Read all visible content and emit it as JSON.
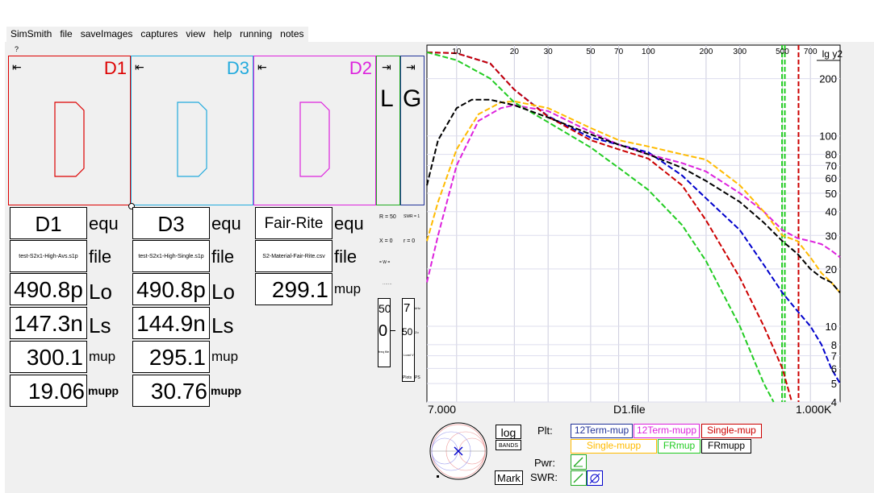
{
  "menu": [
    "SimSmith",
    "file",
    "saveImages",
    "captures",
    "view",
    "help",
    "running",
    "notes"
  ],
  "help_mark": "?",
  "colors": {
    "d1": "#dd0000",
    "d3": "#22aadd",
    "d2": "#dd22dd",
    "green": "#22aa22",
    "navy": "#223399",
    "black": "#000000",
    "orange": "#ffbb00",
    "blue": "#0000cc"
  },
  "devices": {
    "d1": {
      "label": "D1",
      "arrow": "⇤"
    },
    "d3": {
      "label": "D3",
      "arrow": "⇤"
    },
    "d2": {
      "label": "D2",
      "arrow": "⇤"
    },
    "l": {
      "label": "L",
      "arrow": "⇥"
    },
    "g": {
      "label": "G",
      "arrow": "⇥"
    }
  },
  "panels": {
    "d1": {
      "name": "D1",
      "equ": "equ",
      "file_value": "test-S2x1-High-Avs.s1p",
      "file": "file",
      "lo_value": "490.8p",
      "lo": "Lo",
      "ls_value": "147.3n",
      "ls": "Ls",
      "mup_value": "300.1",
      "mup": "mup",
      "mupp_value": "19.06",
      "mupp": "mupp"
    },
    "d3": {
      "name": "D3",
      "equ": "equ",
      "file_value": "test-S2x1-High-Single.s1p",
      "file": "file",
      "lo_value": "490.8p",
      "lo": "Lo",
      "ls_value": "144.9n",
      "ls": "Ls",
      "mup_value": "295.1",
      "mup": "mup",
      "mupp_value": "30.76",
      "mupp": "mupp"
    },
    "d2": {
      "name": "Fair-Rite",
      "equ": "equ",
      "file_value": "S2-Material-Fair-Rite.csv",
      "file": "file",
      "mup_value": "299.1",
      "mup": "mup"
    }
  },
  "readouts": {
    "r": "R = 50",
    "swr": "SWR = 1",
    "x": "X = 0",
    "rho": "r = 0",
    "w": "= W =",
    "dots": "·······"
  },
  "mini": {
    "a_top": "50",
    "a_mid": "0",
    "a_bot": "freq file",
    "b_top": "7",
    "b_top_unit": "kHz",
    "b_mid": "50",
    "b_mid_unit": "Zo",
    "b_bot": "Load V",
    "b_foot_a": "Plots",
    "b_foot_b": "PS"
  },
  "chart_data": {
    "type": "line",
    "xlabel": "D1.file",
    "x_scale": "log",
    "x_min_label": "7.000",
    "x_max_label": "1.000K",
    "xlim": [
      7,
      1000
    ],
    "x_ticks": [
      10,
      20,
      30,
      50,
      70,
      100,
      200,
      300,
      500,
      700
    ],
    "y_scale": "log",
    "ylim": [
      4,
      300
    ],
    "y_axis_title": "lg y2",
    "y_ticks": [
      200,
      100,
      80,
      70,
      60,
      50,
      40,
      30,
      20,
      10,
      8,
      7,
      6,
      5,
      4
    ],
    "series": [
      {
        "name": "12Term-mup",
        "color": "#0000cc",
        "dashed": true,
        "x": [
          7,
          10,
          15,
          20,
          30,
          50,
          70,
          100,
          150,
          200,
          300,
          400,
          500,
          600,
          700,
          800,
          900,
          1000
        ],
        "y": [
          275,
          272,
          240,
          175,
          127,
          98,
          90,
          82,
          62,
          47,
          32,
          21,
          15,
          12,
          10,
          8,
          6,
          5
        ]
      },
      {
        "name": "12Term-mupp",
        "color": "#dd22dd",
        "dashed": true,
        "x": [
          7,
          8,
          10,
          13,
          17,
          20,
          30,
          50,
          70,
          100,
          150,
          200,
          300,
          400,
          500,
          600,
          700,
          800,
          900,
          1000
        ],
        "y": [
          17,
          30,
          70,
          120,
          140,
          145,
          135,
          105,
          90,
          80,
          72,
          65,
          50,
          40,
          32,
          29,
          28,
          27,
          25,
          23
        ]
      },
      {
        "name": "Single-mup",
        "color": "#cc0000",
        "dashed": true,
        "x": [
          7,
          10,
          15,
          20,
          30,
          50,
          70,
          100,
          150,
          200,
          300,
          400,
          500,
          560
        ],
        "y": [
          275,
          272,
          240,
          175,
          126,
          95,
          85,
          76,
          55,
          36,
          18,
          10,
          6,
          4
        ]
      },
      {
        "name": "Single-mupp",
        "color": "#ffbb00",
        "dashed": true,
        "x": [
          7,
          8,
          10,
          13,
          17,
          20,
          30,
          50,
          70,
          100,
          150,
          200,
          300,
          400,
          500,
          600,
          700,
          800,
          900,
          1000
        ],
        "y": [
          28,
          45,
          85,
          130,
          150,
          152,
          140,
          110,
          95,
          88,
          80,
          75,
          55,
          40,
          30,
          28,
          23,
          19,
          17,
          15
        ]
      },
      {
        "name": "FRmup",
        "color": "#22cc22",
        "dashed": true,
        "x": [
          7,
          10,
          15,
          20,
          30,
          50,
          70,
          100,
          150,
          200,
          300,
          400,
          450
        ],
        "y": [
          275,
          250,
          200,
          150,
          118,
          87,
          68,
          52,
          34,
          22,
          10,
          5,
          4
        ]
      },
      {
        "name": "FRmupp",
        "color": "#000000",
        "dashed": true,
        "x": [
          7,
          8,
          10,
          12,
          15,
          20,
          30,
          50,
          70,
          100,
          150,
          200,
          300,
          400,
          500,
          600,
          700,
          800,
          900,
          1000
        ],
        "y": [
          55,
          95,
          140,
          155,
          155,
          145,
          125,
          102,
          90,
          80,
          68,
          58,
          45,
          35,
          28,
          24,
          20,
          18,
          17,
          15
        ]
      }
    ],
    "vlines": [
      {
        "x": 498,
        "color": "#22cc22"
      },
      {
        "x": 515,
        "color": "#22cc22"
      },
      {
        "x": 607,
        "color": "#cc0000"
      }
    ]
  },
  "controls": {
    "log": "log",
    "bands": "BANDS",
    "mark": "Mark",
    "plt": "Plt:",
    "pwr": "Pwr:",
    "swr": "SWR:"
  },
  "legend": [
    {
      "name": "12Term-mup",
      "color": "#223399"
    },
    {
      "name": "12Term-mupp",
      "color": "#dd22dd"
    },
    {
      "name": "Single-mup",
      "color": "#cc0000"
    },
    {
      "name": "Single-mupp",
      "color": "#ffbb00"
    },
    {
      "name": "FRmup",
      "color": "#22cc22"
    },
    {
      "name": "FRmupp",
      "color": "#000000"
    }
  ]
}
